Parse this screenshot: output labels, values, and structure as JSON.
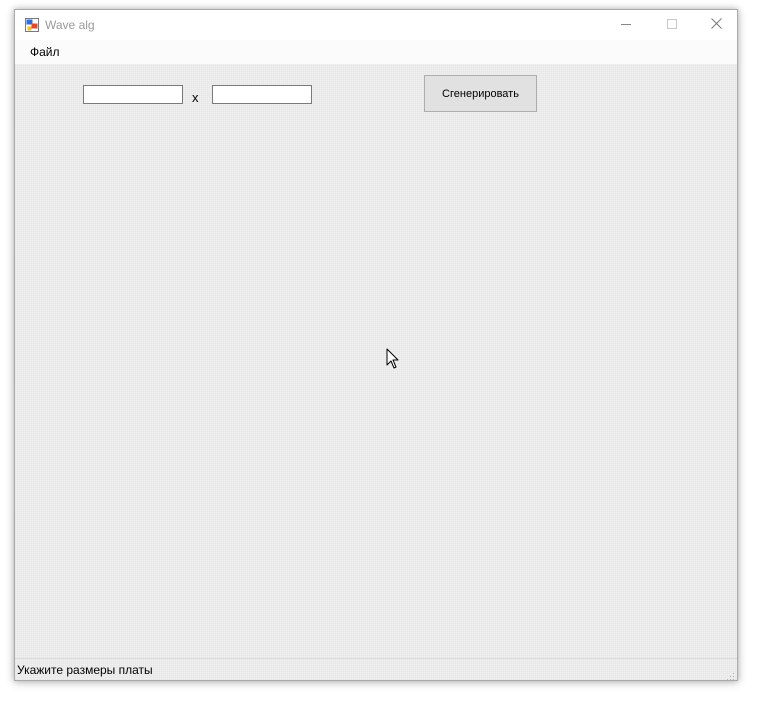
{
  "window": {
    "title": "Wave alg",
    "icon": "winforms-app-icon"
  },
  "caption_buttons": {
    "minimize_icon": "minimize-icon",
    "maximize_icon": "maximize-icon",
    "close_icon": "close-icon"
  },
  "menu": {
    "items": [
      {
        "label": "Файл"
      }
    ]
  },
  "form": {
    "width_input": {
      "value": "",
      "placeholder": ""
    },
    "separator": "x",
    "height_input": {
      "value": "",
      "placeholder": ""
    },
    "generate_button": "Сгенерировать"
  },
  "status": {
    "text": "Укажите размеры платы"
  },
  "colors": {
    "window_bg": "#f0f0f0",
    "title_text": "#9a9a9a",
    "button_bg": "#e1e1e1",
    "button_border": "#adadad"
  }
}
